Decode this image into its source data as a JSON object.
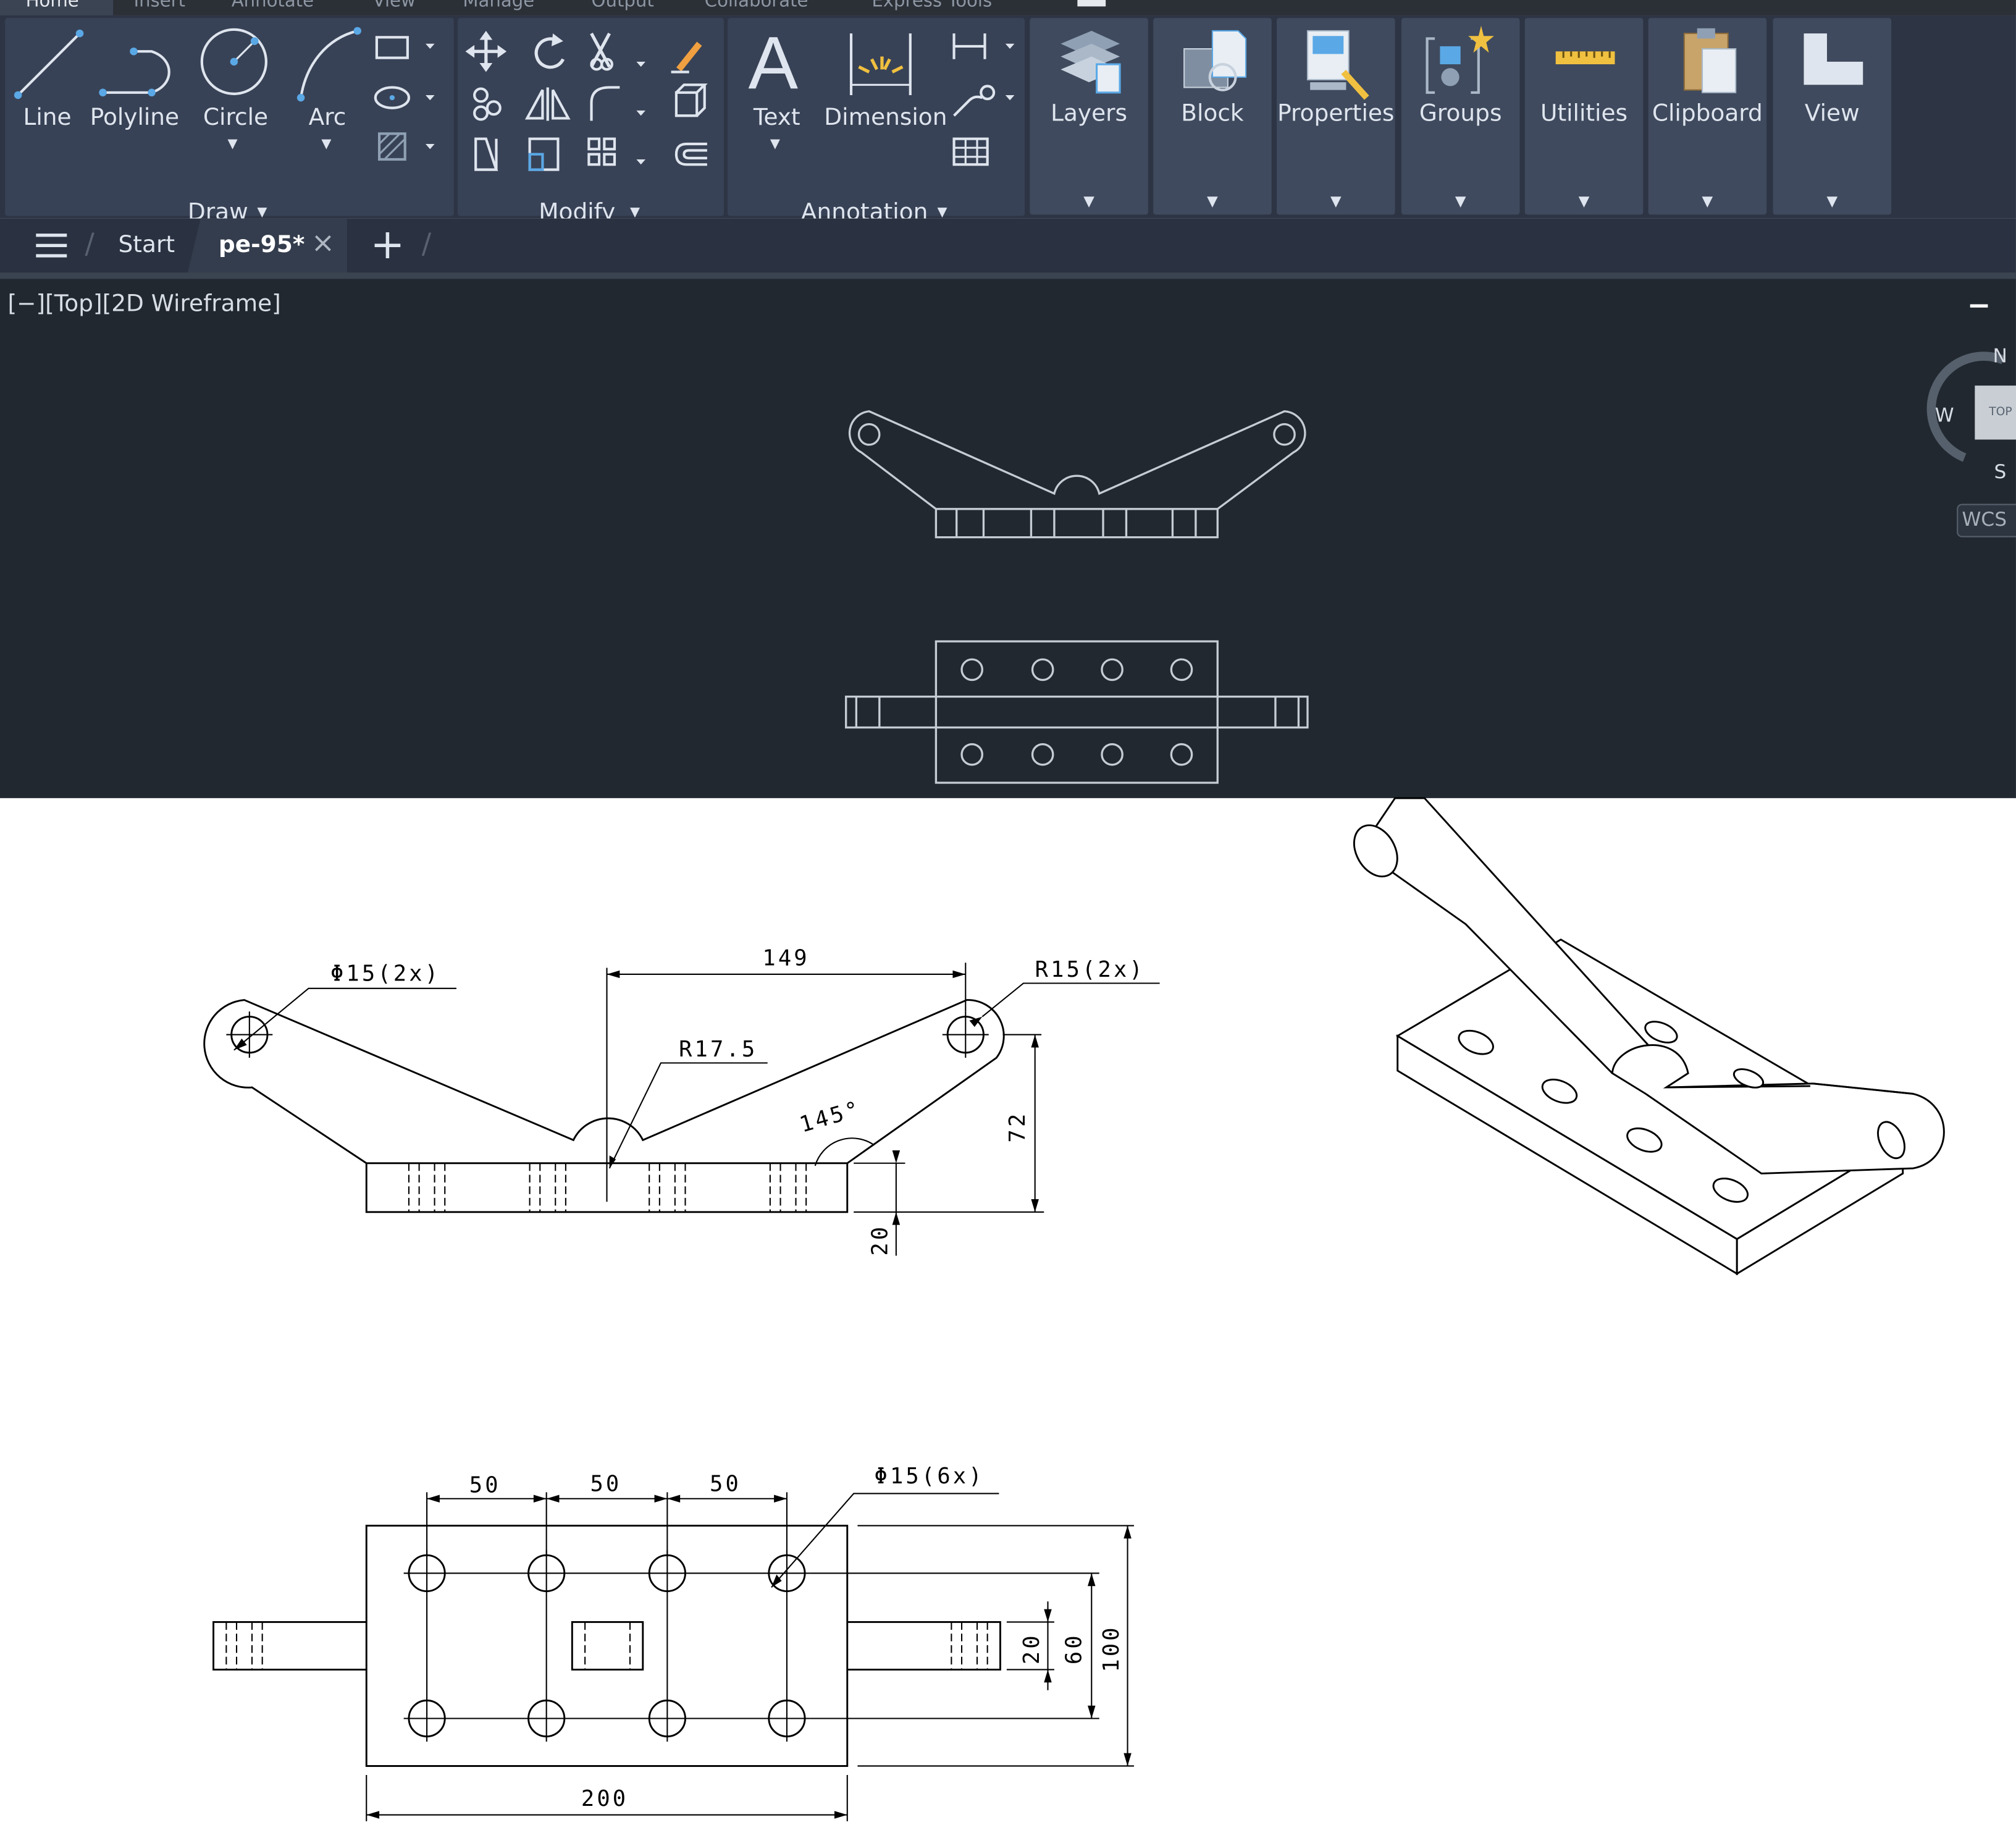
{
  "ribbon_tabs": [
    "Home",
    "Insert",
    "Annotate",
    "View",
    "Manage",
    "Output",
    "Collaborate",
    "Express Tools"
  ],
  "draw_tools": [
    "Line",
    "Polyline",
    "Circle",
    "Arc"
  ],
  "panels": {
    "draw": "Draw",
    "modify": "Modify",
    "annotation": "Annotation"
  },
  "annotation_tools": [
    "Text",
    "Dimension"
  ],
  "big_panels": [
    "Layers",
    "Block",
    "Properties",
    "Groups",
    "Utilities",
    "Clipboard",
    "View"
  ],
  "file_tabs": {
    "start": "Start",
    "active": "pe-95*",
    "close_glyph": "×",
    "add_glyph": "+"
  },
  "viewport": {
    "label": "[−][Top][2D Wireframe]",
    "minimize_glyph": "−"
  },
  "viewcube": {
    "north": "N",
    "west": "W",
    "south": "S",
    "face": "TOP",
    "wcs": "WCS"
  },
  "drawing_dims": {
    "phi15_2x": "Φ15(2x)",
    "r15_2x": "R15(2x)",
    "d149": "149",
    "r17_5": "R17.5",
    "a145": "145°",
    "d72": "72",
    "d20_front": "20",
    "d50_a": "50",
    "d50_b": "50",
    "d50_c": "50",
    "phi15_6x": "Φ15(6x)",
    "d20_top": "20",
    "d60": "60",
    "d100": "100",
    "d200": "200"
  },
  "colors": {
    "ribbon_bg": "#2d3545",
    "panel_bg": "#384256",
    "viewport_bg": "#212830",
    "accent_blue": "#5aa8e6",
    "cad_line": "#c6ccd4"
  }
}
